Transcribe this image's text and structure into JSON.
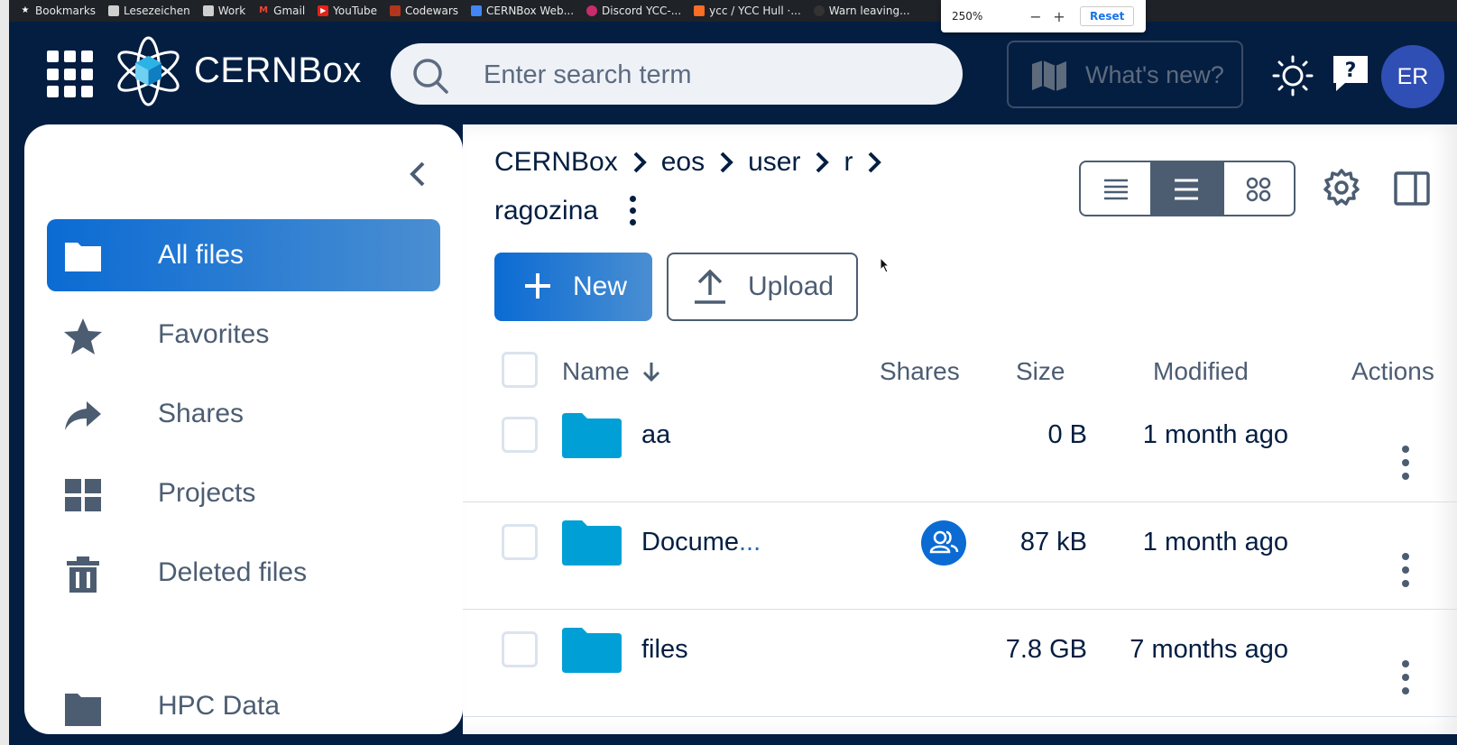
{
  "browser": {
    "bookmarks": [
      {
        "label": "Bookmarks",
        "icon": "star-icon"
      },
      {
        "label": "Lesezeichen",
        "icon": "folder-icon"
      },
      {
        "label": "Work",
        "icon": "folder-icon"
      },
      {
        "label": "Gmail",
        "icon": "gmail-icon"
      },
      {
        "label": "YouTube",
        "icon": "youtube-icon"
      },
      {
        "label": "Codewars",
        "icon": "codewars-icon"
      },
      {
        "label": "CERNBox Web...",
        "icon": "doc-icon"
      },
      {
        "label": "Discord YCC-...",
        "icon": "discord-icon"
      },
      {
        "label": "ycc / YCC Hull ·...",
        "icon": "gitlab-icon"
      },
      {
        "label": "Warn leaving...",
        "icon": "github-icon"
      }
    ],
    "zoom": {
      "value": "250%",
      "minus": "−",
      "plus": "+",
      "reset": "Reset"
    }
  },
  "app": {
    "brand_light": "CERN",
    "brand_bold": "Box",
    "search_placeholder": "Enter search term",
    "whats_new": "What's new?",
    "avatar_initials": "ER",
    "accent": "#0b6bd3",
    "folder_color": "#00a0d6"
  },
  "sidebar": {
    "items": [
      {
        "label": "All files",
        "icon": "folder-icon",
        "active": true
      },
      {
        "label": "Favorites",
        "icon": "star-icon"
      },
      {
        "label": "Shares",
        "icon": "share-arrow-icon"
      },
      {
        "label": "Projects",
        "icon": "projects-grid-icon"
      },
      {
        "label": "Deleted files",
        "icon": "trash-icon"
      },
      {
        "label": "HPC Data",
        "icon": "folder-icon"
      }
    ]
  },
  "breadcrumb": [
    "CERNBox",
    "eos",
    "user",
    "r",
    "ragozina"
  ],
  "toolbar": {
    "new_label": "New",
    "upload_label": "Upload"
  },
  "table": {
    "headers": {
      "name": "Name",
      "shares": "Shares",
      "size": "Size",
      "modified": "Modified",
      "actions": "Actions"
    },
    "rows": [
      {
        "name": "aa",
        "name_suffix": "",
        "shared": false,
        "size": "0 B",
        "modified": "1 month ago"
      },
      {
        "name": "Docume",
        "name_suffix": "...",
        "shared": true,
        "size": "87 kB",
        "modified": "1 month ago"
      },
      {
        "name": "files",
        "name_suffix": "",
        "shared": false,
        "size": "7.8 GB",
        "modified": "7 months ago"
      }
    ]
  }
}
